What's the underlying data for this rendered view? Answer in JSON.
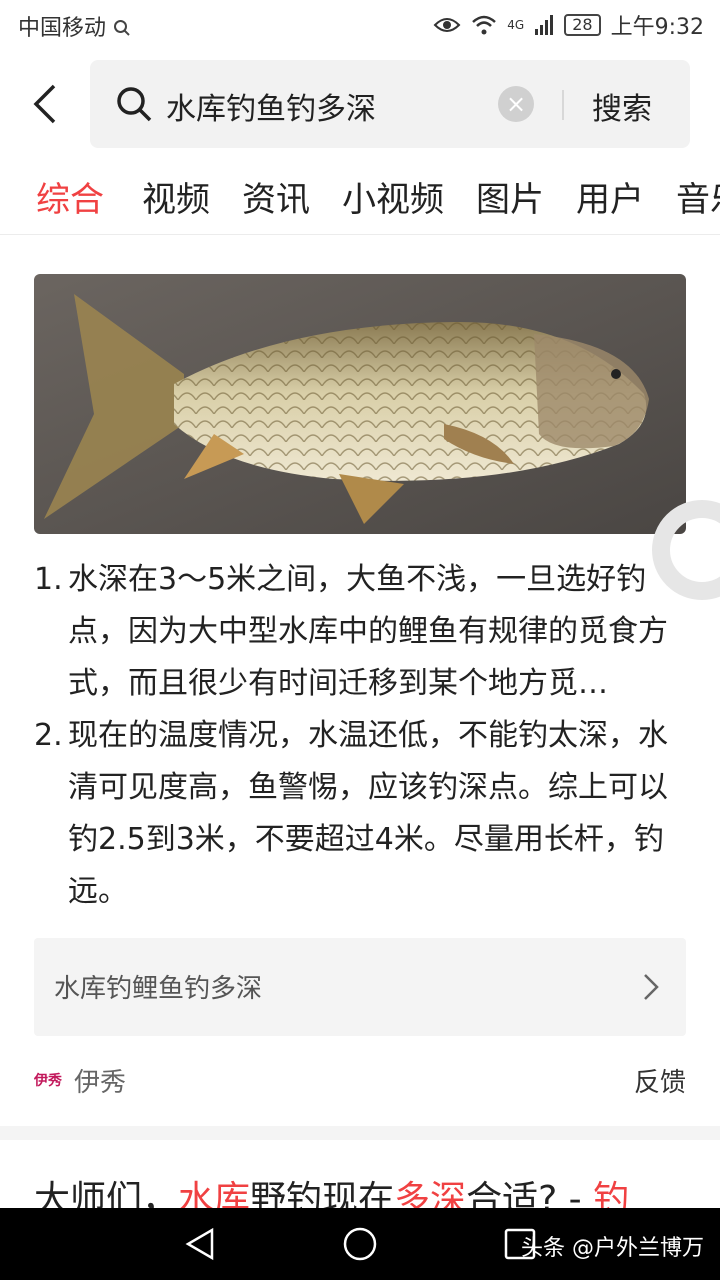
{
  "status_bar": {
    "carrier": "中国移动",
    "network": "4G",
    "battery": "28",
    "time": "上午9:32"
  },
  "search": {
    "query": "水库钓鱼钓多深",
    "button": "搜索",
    "clear_symbol": "×"
  },
  "tabs": [
    {
      "label": "综合",
      "active": true
    },
    {
      "label": "视频"
    },
    {
      "label": "资讯"
    },
    {
      "label": "小视频"
    },
    {
      "label": "图片"
    },
    {
      "label": "用户"
    },
    {
      "label": "音乐"
    }
  ],
  "card": {
    "image_alt": "carp fish",
    "answers": [
      {
        "num": "1.",
        "text": "水深在3～5米之间，大鱼不浅，一旦选好钓点，因为大中型水库中的鲤鱼有规律的觅食方式，而且很少有时间迁移到某个地方觅…"
      },
      {
        "num": "2.",
        "text": "现在的温度情况，水温还低，不能钓太深，水清可见度高，鱼警惕，应该钓深点。综上可以钓2.5到3米，不要超过4米。尽量用长杆，钓远。"
      }
    ],
    "related": "水库钓鲤鱼钓多深",
    "source_logo": "伊秀",
    "source": "伊秀",
    "feedback": "反馈"
  },
  "next_result": {
    "part1": "大师们，",
    "part2": "水库",
    "part3": "野钓现在",
    "part4": "多深",
    "part5": "合适? - ",
    "part6": "钓"
  },
  "watermark": "头条 @户外兰博万",
  "colors": {
    "accent": "#f04142",
    "nav": "#000000"
  }
}
